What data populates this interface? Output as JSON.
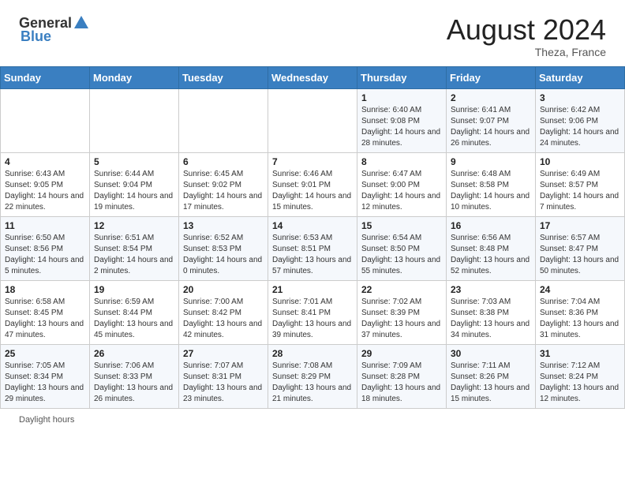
{
  "header": {
    "logo_general": "General",
    "logo_blue": "Blue",
    "month_year": "August 2024",
    "location": "Theza, France"
  },
  "calendar": {
    "days_of_week": [
      "Sunday",
      "Monday",
      "Tuesday",
      "Wednesday",
      "Thursday",
      "Friday",
      "Saturday"
    ],
    "weeks": [
      [
        {
          "day": "",
          "info": ""
        },
        {
          "day": "",
          "info": ""
        },
        {
          "day": "",
          "info": ""
        },
        {
          "day": "",
          "info": ""
        },
        {
          "day": "1",
          "info": "Sunrise: 6:40 AM\nSunset: 9:08 PM\nDaylight: 14 hours and 28 minutes."
        },
        {
          "day": "2",
          "info": "Sunrise: 6:41 AM\nSunset: 9:07 PM\nDaylight: 14 hours and 26 minutes."
        },
        {
          "day": "3",
          "info": "Sunrise: 6:42 AM\nSunset: 9:06 PM\nDaylight: 14 hours and 24 minutes."
        }
      ],
      [
        {
          "day": "4",
          "info": "Sunrise: 6:43 AM\nSunset: 9:05 PM\nDaylight: 14 hours and 22 minutes."
        },
        {
          "day": "5",
          "info": "Sunrise: 6:44 AM\nSunset: 9:04 PM\nDaylight: 14 hours and 19 minutes."
        },
        {
          "day": "6",
          "info": "Sunrise: 6:45 AM\nSunset: 9:02 PM\nDaylight: 14 hours and 17 minutes."
        },
        {
          "day": "7",
          "info": "Sunrise: 6:46 AM\nSunset: 9:01 PM\nDaylight: 14 hours and 15 minutes."
        },
        {
          "day": "8",
          "info": "Sunrise: 6:47 AM\nSunset: 9:00 PM\nDaylight: 14 hours and 12 minutes."
        },
        {
          "day": "9",
          "info": "Sunrise: 6:48 AM\nSunset: 8:58 PM\nDaylight: 14 hours and 10 minutes."
        },
        {
          "day": "10",
          "info": "Sunrise: 6:49 AM\nSunset: 8:57 PM\nDaylight: 14 hours and 7 minutes."
        }
      ],
      [
        {
          "day": "11",
          "info": "Sunrise: 6:50 AM\nSunset: 8:56 PM\nDaylight: 14 hours and 5 minutes."
        },
        {
          "day": "12",
          "info": "Sunrise: 6:51 AM\nSunset: 8:54 PM\nDaylight: 14 hours and 2 minutes."
        },
        {
          "day": "13",
          "info": "Sunrise: 6:52 AM\nSunset: 8:53 PM\nDaylight: 14 hours and 0 minutes."
        },
        {
          "day": "14",
          "info": "Sunrise: 6:53 AM\nSunset: 8:51 PM\nDaylight: 13 hours and 57 minutes."
        },
        {
          "day": "15",
          "info": "Sunrise: 6:54 AM\nSunset: 8:50 PM\nDaylight: 13 hours and 55 minutes."
        },
        {
          "day": "16",
          "info": "Sunrise: 6:56 AM\nSunset: 8:48 PM\nDaylight: 13 hours and 52 minutes."
        },
        {
          "day": "17",
          "info": "Sunrise: 6:57 AM\nSunset: 8:47 PM\nDaylight: 13 hours and 50 minutes."
        }
      ],
      [
        {
          "day": "18",
          "info": "Sunrise: 6:58 AM\nSunset: 8:45 PM\nDaylight: 13 hours and 47 minutes."
        },
        {
          "day": "19",
          "info": "Sunrise: 6:59 AM\nSunset: 8:44 PM\nDaylight: 13 hours and 45 minutes."
        },
        {
          "day": "20",
          "info": "Sunrise: 7:00 AM\nSunset: 8:42 PM\nDaylight: 13 hours and 42 minutes."
        },
        {
          "day": "21",
          "info": "Sunrise: 7:01 AM\nSunset: 8:41 PM\nDaylight: 13 hours and 39 minutes."
        },
        {
          "day": "22",
          "info": "Sunrise: 7:02 AM\nSunset: 8:39 PM\nDaylight: 13 hours and 37 minutes."
        },
        {
          "day": "23",
          "info": "Sunrise: 7:03 AM\nSunset: 8:38 PM\nDaylight: 13 hours and 34 minutes."
        },
        {
          "day": "24",
          "info": "Sunrise: 7:04 AM\nSunset: 8:36 PM\nDaylight: 13 hours and 31 minutes."
        }
      ],
      [
        {
          "day": "25",
          "info": "Sunrise: 7:05 AM\nSunset: 8:34 PM\nDaylight: 13 hours and 29 minutes."
        },
        {
          "day": "26",
          "info": "Sunrise: 7:06 AM\nSunset: 8:33 PM\nDaylight: 13 hours and 26 minutes."
        },
        {
          "day": "27",
          "info": "Sunrise: 7:07 AM\nSunset: 8:31 PM\nDaylight: 13 hours and 23 minutes."
        },
        {
          "day": "28",
          "info": "Sunrise: 7:08 AM\nSunset: 8:29 PM\nDaylight: 13 hours and 21 minutes."
        },
        {
          "day": "29",
          "info": "Sunrise: 7:09 AM\nSunset: 8:28 PM\nDaylight: 13 hours and 18 minutes."
        },
        {
          "day": "30",
          "info": "Sunrise: 7:11 AM\nSunset: 8:26 PM\nDaylight: 13 hours and 15 minutes."
        },
        {
          "day": "31",
          "info": "Sunrise: 7:12 AM\nSunset: 8:24 PM\nDaylight: 13 hours and 12 minutes."
        }
      ]
    ]
  },
  "footer": {
    "daylight_hours_label": "Daylight hours"
  }
}
